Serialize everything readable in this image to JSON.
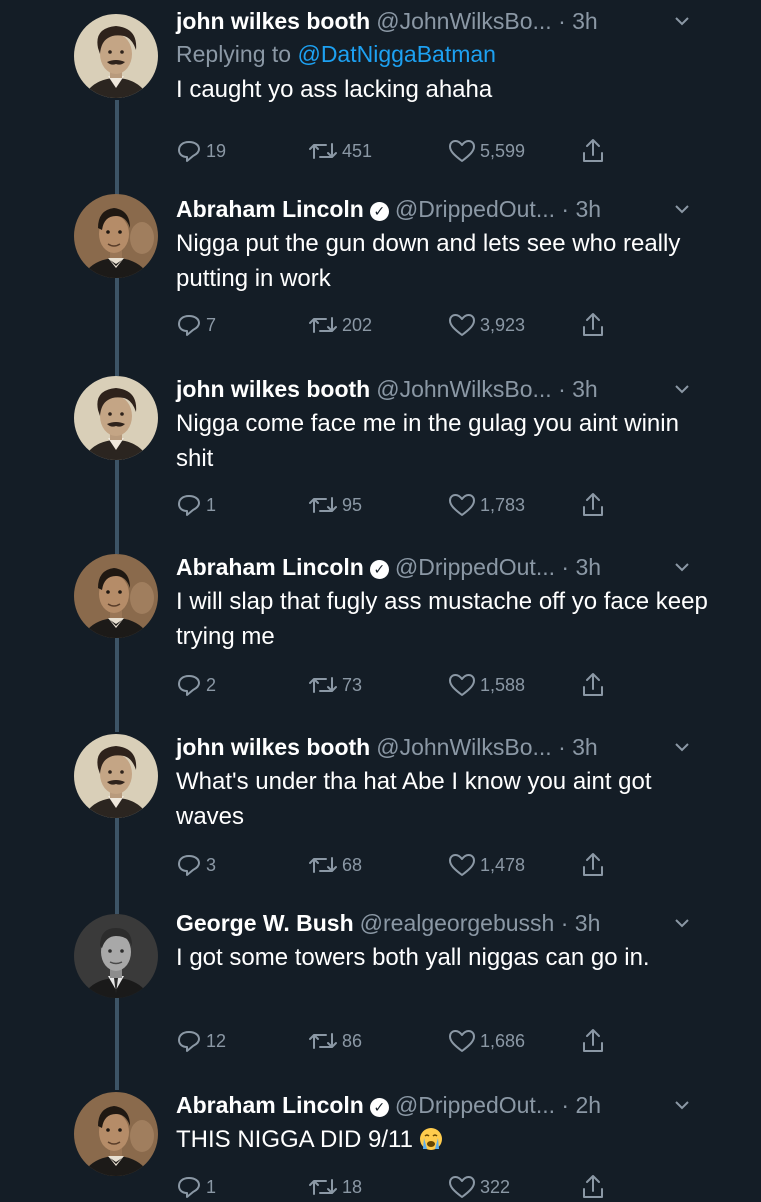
{
  "colors": {
    "background": "#141d26",
    "primary_text": "#ffffff",
    "secondary_text": "#8b98a5",
    "link": "#1da1f2",
    "thread_line": "#3d5466"
  },
  "tweets": [
    {
      "name": "john wilkes booth",
      "handle": "@JohnWilksBo...",
      "time": "· 3h",
      "verified": false,
      "avatar": "booth-portrait",
      "reply_prefix": "Replying to",
      "reply_mention": "@DatNiggaBatman",
      "text": "I caught yo ass lacking ahaha",
      "replies": "19",
      "retweets": "451",
      "likes": "5,599"
    },
    {
      "name": "Abraham Lincoln",
      "handle": "@DrippedOut...",
      "time": "· 3h",
      "verified": true,
      "avatar": "lincoln-portrait",
      "text": "Nigga put the gun down and lets see who really putting in work",
      "replies": "7",
      "retweets": "202",
      "likes": "3,923"
    },
    {
      "name": "john wilkes booth",
      "handle": "@JohnWilksBo...",
      "time": "· 3h",
      "verified": false,
      "avatar": "booth-portrait",
      "text": "Nigga come face me in the gulag you aint winin shit",
      "replies": "1",
      "retweets": "95",
      "likes": "1,783"
    },
    {
      "name": "Abraham Lincoln",
      "handle": "@DrippedOut...",
      "time": "· 3h",
      "verified": true,
      "avatar": "lincoln-portrait",
      "text": "I will slap that fugly ass mustache off yo face keep trying me",
      "replies": "2",
      "retweets": "73",
      "likes": "1,588"
    },
    {
      "name": "john wilkes booth",
      "handle": "@JohnWilksBo...",
      "time": "· 3h",
      "verified": false,
      "avatar": "booth-portrait",
      "text": "What's under tha hat Abe I know you aint got waves",
      "replies": "3",
      "retweets": "68",
      "likes": "1,478"
    },
    {
      "name": "George W. Bush",
      "handle": "@realgeorgebussh",
      "time": "· 3h",
      "verified": false,
      "avatar": "bush-portrait",
      "text": "I got some towers both yall niggas can go in.",
      "replies": "12",
      "retweets": "86",
      "likes": "1,686"
    },
    {
      "name": "Abraham Lincoln",
      "handle": "@DrippedOut...",
      "time": "· 2h",
      "verified": true,
      "avatar": "lincoln-portrait",
      "text": "THIS NIGGA DID 9/11",
      "emoji": "loudly-crying-face",
      "replies": "1",
      "retweets": "18",
      "likes": "322"
    }
  ]
}
